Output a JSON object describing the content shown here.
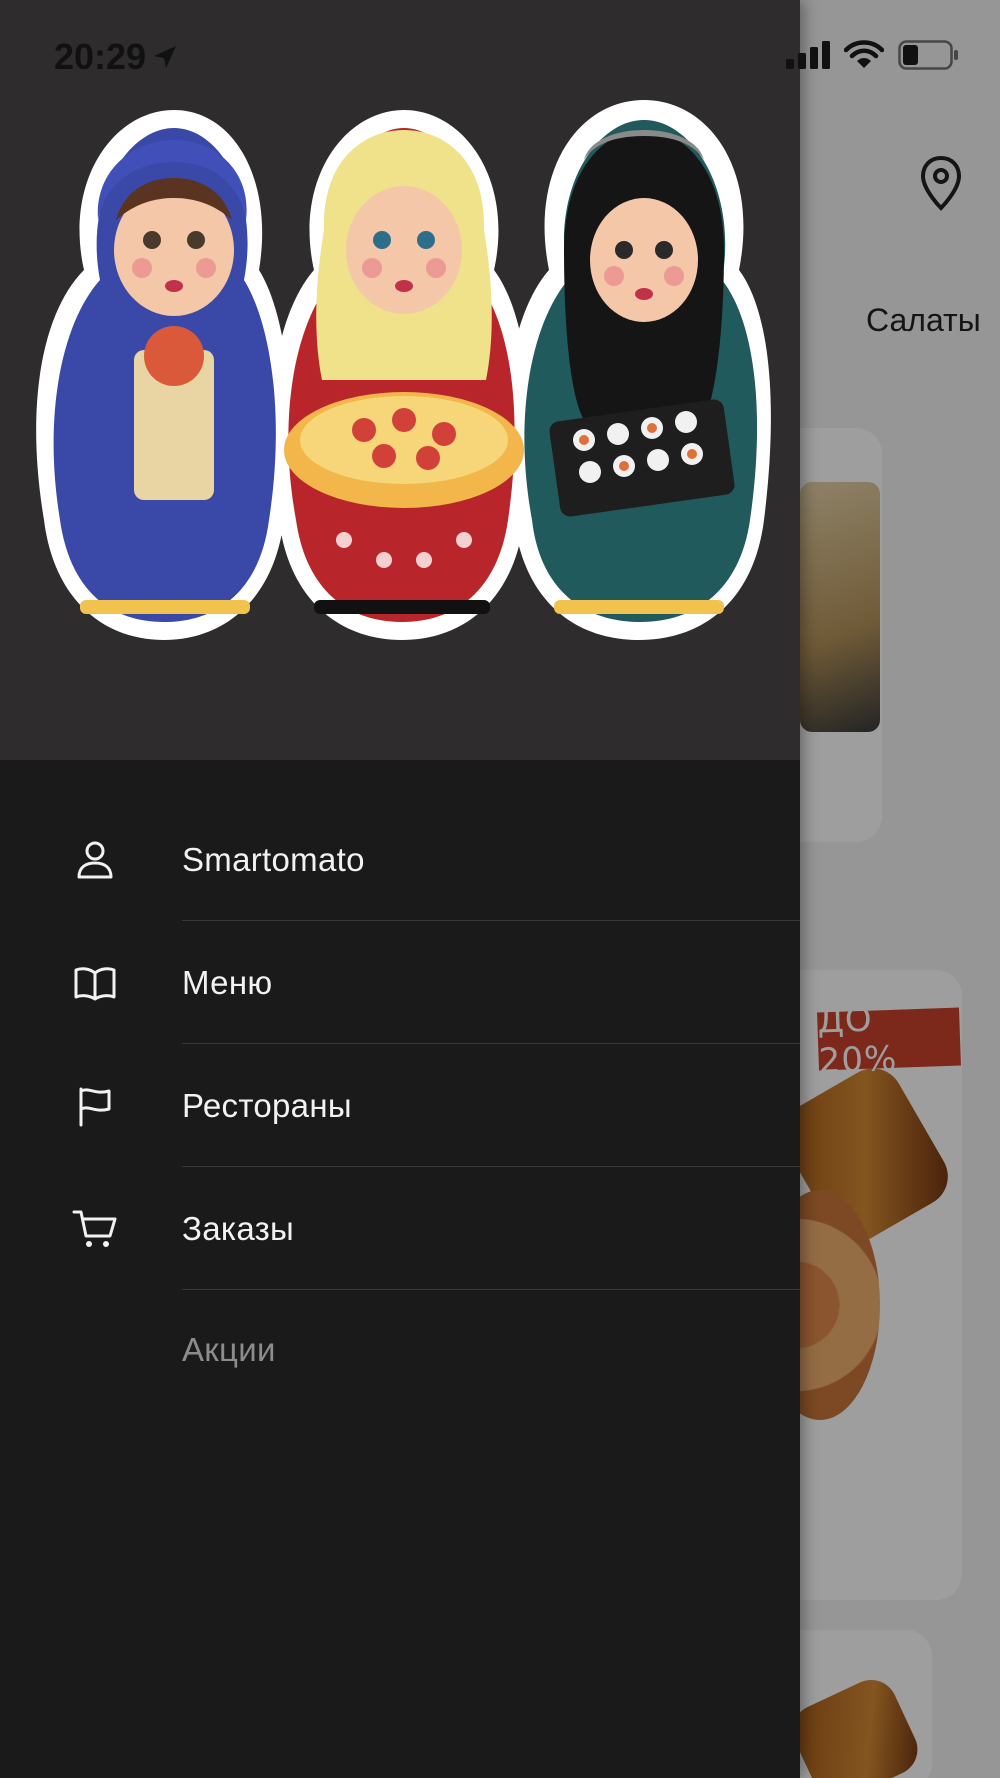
{
  "status_bar": {
    "time": "20:29"
  },
  "background": {
    "category_tab": "Салаты",
    "promo_badge": "ДО 20%",
    "icons": [
      "location-pin-icon"
    ]
  },
  "drawer": {
    "menu": [
      {
        "label": "Smartomato",
        "icon": "user-icon"
      },
      {
        "label": "Меню",
        "icon": "book-icon"
      },
      {
        "label": "Рестораны",
        "icon": "flag-icon"
      },
      {
        "label": "Заказы",
        "icon": "cart-icon"
      },
      {
        "label": "Акции",
        "icon": ""
      }
    ]
  },
  "colors": {
    "drawer_bg": "#1a1a1a",
    "header_bg": "#2e2c2d",
    "menu_text": "#f2f2f2",
    "muted_text": "#8c8c8c",
    "divider": "#3a3a3a"
  }
}
